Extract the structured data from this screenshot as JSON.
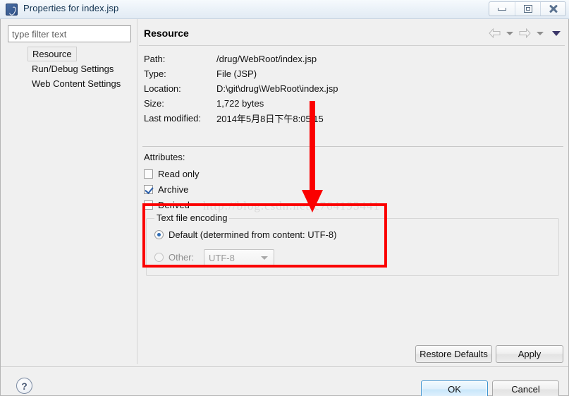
{
  "window": {
    "title": "Properties for index.jsp",
    "app_icon": "eclipse-icon",
    "controls": {
      "minimize": "minimize-icon",
      "maximize": "maximize-icon",
      "close": "close-icon"
    }
  },
  "sidebar": {
    "filter": {
      "placeholder": "type filter text",
      "value": ""
    },
    "items": [
      {
        "label": "Resource",
        "selected": true
      },
      {
        "label": "Run/Debug Settings",
        "selected": false
      },
      {
        "label": "Web Content Settings",
        "selected": false
      }
    ]
  },
  "content": {
    "page_title": "Resource",
    "nav": {
      "back": "back-arrow-icon",
      "back_menu": "chevron-down-icon",
      "forward": "forward-arrow-icon",
      "forward_menu": "chevron-down-icon",
      "view_menu": "view-menu-icon"
    },
    "details": [
      {
        "label": "Path:",
        "value": "/drug/WebRoot/index.jsp"
      },
      {
        "label": "Type:",
        "value": "File  (JSP)"
      },
      {
        "label": "Location:",
        "value": "D:\\git\\drug\\WebRoot\\index.jsp"
      },
      {
        "label": "Size:",
        "value": "1,722  bytes"
      },
      {
        "label": "Last modified:",
        "value": "2014年5月8日下午8:05:15"
      }
    ],
    "attributes": {
      "label": "Attributes:",
      "checkboxes": [
        {
          "label": "Read only",
          "checked": false
        },
        {
          "label": "Archive",
          "checked": true
        },
        {
          "label": "Derived",
          "checked": false
        }
      ]
    },
    "encoding_group": {
      "title": "Text file encoding",
      "default_option": "Default (determined from content: UTF-8)",
      "default_selected": true,
      "other_option": "Other:",
      "other_selected": false,
      "combo_value": "UTF-8",
      "combo_enabled": false
    },
    "buttons": {
      "restore_defaults": "Restore Defaults",
      "apply": "Apply"
    }
  },
  "footer": {
    "help": "?",
    "ok": "OK",
    "cancel": "Cancel"
  },
  "annotations": {
    "watermark": "http://blog.csdn.net/c764193441",
    "highlight_color": "#fb0000",
    "arrow": "red-down-arrow",
    "rect": "red-highlight-rect"
  }
}
